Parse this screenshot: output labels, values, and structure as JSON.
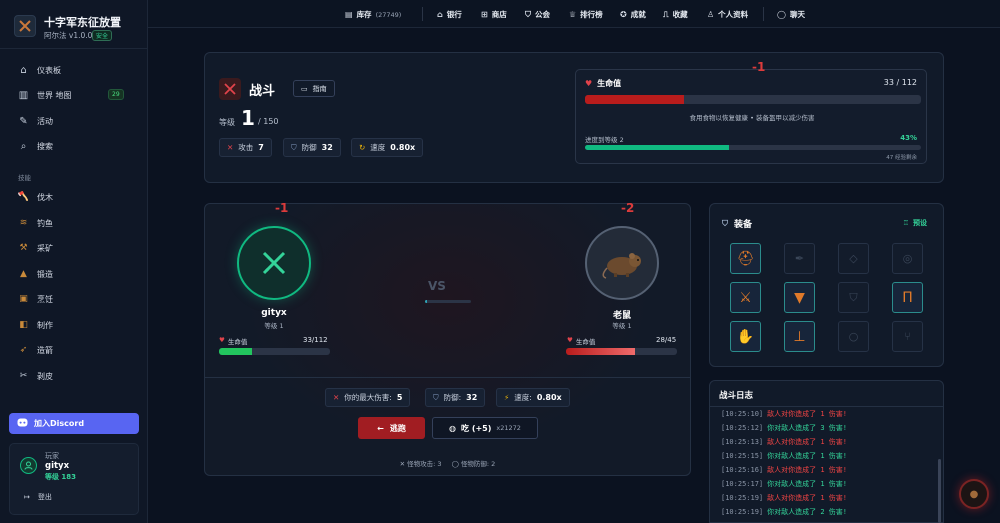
{
  "app": {
    "title": "十字军东征放置",
    "author_version": "阿尔法 v1.0.0",
    "safe_badge": "安全"
  },
  "sidebar": {
    "nav": [
      {
        "label": "仪表板",
        "icon": "home-icon"
      },
      {
        "label": "世界 地图",
        "icon": "map-icon",
        "badge": "29"
      },
      {
        "label": "活动",
        "icon": "activity-icon"
      },
      {
        "label": "搜索",
        "icon": "search-icon"
      }
    ],
    "skills_header": "技能",
    "skills": [
      {
        "label": "伐木",
        "icon": "axe-icon"
      },
      {
        "label": "钓鱼",
        "icon": "fish-icon"
      },
      {
        "label": "采矿",
        "icon": "pickaxe-icon"
      },
      {
        "label": "锻造",
        "icon": "anvil-icon"
      },
      {
        "label": "烹饪",
        "icon": "cooking-icon"
      },
      {
        "label": "制作",
        "icon": "crafting-icon"
      },
      {
        "label": "造箭",
        "icon": "arrow-icon"
      },
      {
        "label": "剥皮",
        "icon": "scissors-icon"
      }
    ],
    "discord_label": "加入Discord",
    "user": {
      "role": "玩家",
      "name": "gityx",
      "level": "等级 183",
      "logout": "登出"
    }
  },
  "topbar": {
    "inventory": {
      "label": "库存",
      "count": "(27749)"
    },
    "items": [
      {
        "label": "银行",
        "icon": "bank-icon"
      },
      {
        "label": "商店",
        "icon": "shop-icon"
      },
      {
        "label": "公会",
        "icon": "guild-shield-icon"
      },
      {
        "label": "排行榜",
        "icon": "trophy-icon"
      },
      {
        "label": "成就",
        "icon": "achievement-icon"
      },
      {
        "label": "收藏",
        "icon": "collection-icon"
      },
      {
        "label": "个人资料",
        "icon": "user-icon"
      }
    ],
    "chat": "聊天"
  },
  "combat": {
    "title": "战斗",
    "guide": "指南",
    "level_label": "等级",
    "level": "1",
    "level_max": "/ 150",
    "stats": [
      {
        "label": "攻击",
        "value": "7",
        "icon": "swords-icon"
      },
      {
        "label": "防御",
        "value": "32",
        "icon": "shield-icon"
      },
      {
        "label": "速度",
        "value": "0.80x",
        "icon": "speed-icon"
      }
    ],
    "hp": {
      "label": "生命值",
      "value": "33 / 112",
      "fraction": 0.295,
      "hint": "食用食物以恢复健康 • 装备盔甲以减少伤害",
      "float": "-1"
    },
    "progress": {
      "label": "进度到等级 2",
      "percent": "43%",
      "fraction": 0.43,
      "remaining": "47 经验剩余"
    }
  },
  "battle": {
    "player": {
      "name": "gityx",
      "level": "等级 1",
      "hp_label": "生命值",
      "hp": "33/112",
      "hp_fraction": 0.295,
      "float": "-1"
    },
    "enemy": {
      "name": "老鼠",
      "level": "等级 1",
      "hp_label": "生命值",
      "hp": "28/45",
      "hp_fraction": 0.62,
      "float": "-2"
    },
    "vs": "VS",
    "turn_fraction": 0.04,
    "stats": [
      {
        "label": "你的最大伤害:",
        "value": "5",
        "icon": "swords-icon"
      },
      {
        "label": "防御:",
        "value": "32",
        "icon": "shield-icon"
      },
      {
        "label": "速度:",
        "value": "0.80x",
        "icon": "speed-icon"
      }
    ],
    "flee": "逃跑",
    "eat": "吃 (+5)",
    "eat_count": "x21272",
    "monster_attack": "怪物攻击: 3",
    "monster_defense": "怪物防御: 2"
  },
  "equipment": {
    "title": "装备",
    "preset": "预设",
    "slots": [
      {
        "icon": "helmet-icon",
        "filled": true
      },
      {
        "icon": "feather-icon",
        "filled": false
      },
      {
        "icon": "gem-icon",
        "filled": false
      },
      {
        "icon": "ring-icon",
        "filled": false
      },
      {
        "icon": "sword-icon",
        "filled": true
      },
      {
        "icon": "chestplate-icon",
        "filled": true
      },
      {
        "icon": "shield-slot-icon",
        "filled": false
      },
      {
        "icon": "leggings-icon",
        "filled": true
      },
      {
        "icon": "gloves-icon",
        "filled": true
      },
      {
        "icon": "boots-icon",
        "filled": true
      },
      {
        "icon": "ring-slot-icon",
        "filled": false
      },
      {
        "icon": "cutlery-icon",
        "filled": false
      }
    ]
  },
  "log": {
    "title": "战斗日志",
    "entries": [
      {
        "time": "[10:25:10]",
        "text": "敌人对你造成了 1 伤害!",
        "type": "enemy"
      },
      {
        "time": "[10:25:12]",
        "text": "你对敌人造成了 3 伤害!",
        "type": "player"
      },
      {
        "time": "[10:25:13]",
        "text": "敌人对你造成了 1 伤害!",
        "type": "enemy"
      },
      {
        "time": "[10:25:15]",
        "text": "你对敌人造成了 1 伤害!",
        "type": "player"
      },
      {
        "time": "[10:25:16]",
        "text": "敌人对你造成了 1 伤害!",
        "type": "enemy"
      },
      {
        "time": "[10:25:17]",
        "text": "你对敌人造成了 1 伤害!",
        "type": "player"
      },
      {
        "time": "[10:25:19]",
        "text": "敌人对你造成了 1 伤害!",
        "type": "enemy"
      },
      {
        "time": "[10:25:19]",
        "text": "你对敌人造成了 2 伤害!",
        "type": "player"
      }
    ]
  },
  "colors": {
    "accent": "#10b981",
    "danger": "#b91c1c",
    "discord": "#5865f2",
    "bg": "#0b1220"
  }
}
